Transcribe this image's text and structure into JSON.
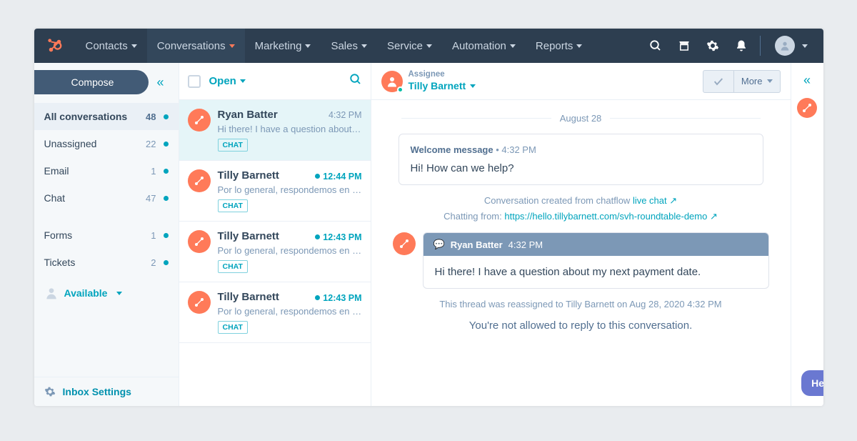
{
  "nav": {
    "items": [
      "Contacts",
      "Conversations",
      "Marketing",
      "Sales",
      "Service",
      "Automation",
      "Reports"
    ],
    "activeIndex": 1
  },
  "sidebar": {
    "compose": "Compose",
    "folders": [
      {
        "label": "All conversations",
        "count": 48,
        "active": true
      },
      {
        "label": "Unassigned",
        "count": 22
      },
      {
        "label": "Email",
        "count": 1
      },
      {
        "label": "Chat",
        "count": 47
      }
    ],
    "secondary": [
      {
        "label": "Forms",
        "count": 1
      },
      {
        "label": "Tickets",
        "count": 2
      }
    ],
    "status": "Available",
    "settings": "Inbox Settings"
  },
  "threadlist": {
    "filter": "Open",
    "threads": [
      {
        "name": "Ryan Batter",
        "time": "4:32 PM",
        "preview": "Hi there! I have a question about …",
        "badge": "CHAT",
        "active": true,
        "unread": false
      },
      {
        "name": "Tilly Barnett",
        "time": "12:44 PM",
        "preview": "Por lo general, respondemos en u…",
        "badge": "CHAT",
        "unread": true
      },
      {
        "name": "Tilly Barnett",
        "time": "12:43 PM",
        "preview": "Por lo general, respondemos en u…",
        "badge": "CHAT",
        "unread": true
      },
      {
        "name": "Tilly Barnett",
        "time": "12:43 PM",
        "preview": "Por lo general, respondemos en u…",
        "badge": "CHAT",
        "unread": true
      }
    ]
  },
  "conv": {
    "assignee_label": "Assignee",
    "assignee_name": "Tilly Barnett",
    "more": "More",
    "date_divider": "August 28",
    "welcome_label": "Welcome message",
    "welcome_time": "4:32 PM",
    "welcome_body": "Hi! How can we help?",
    "created_prefix": "Conversation created from chatflow ",
    "created_link": "live chat",
    "chatting_prefix": "Chatting from: ",
    "chatting_url": "https://hello.tillybarnett.com/svh-roundtable-demo",
    "msg_name": "Ryan Batter",
    "msg_time": "4:32 PM",
    "msg_body": "Hi there! I have a question about my next payment date.",
    "reassigned": "This thread was reassigned to Tilly Barnett on Aug 28, 2020 4:32 PM",
    "not_allowed": "You're not allowed to reply to this conversation."
  },
  "help": "Help"
}
